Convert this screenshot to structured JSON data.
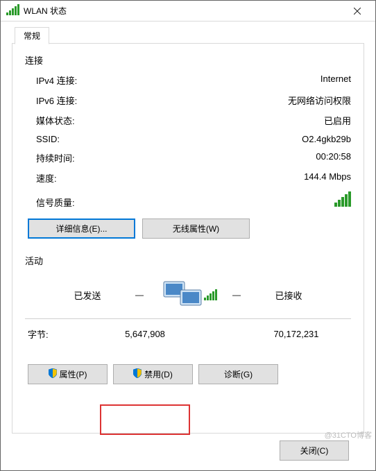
{
  "title": "WLAN 状态",
  "tab": {
    "general": "常规"
  },
  "connection": {
    "heading": "连接",
    "rows": {
      "ipv4": {
        "label": "IPv4 连接:",
        "value": "Internet"
      },
      "ipv6": {
        "label": "IPv6 连接:",
        "value": "无网络访问权限"
      },
      "media": {
        "label": "媒体状态:",
        "value": "已启用"
      },
      "ssid": {
        "label": "SSID:",
        "value": "O2.4gkb29b"
      },
      "duration": {
        "label": "持续时间:",
        "value": "00:20:58"
      },
      "speed": {
        "label": "速度:",
        "value": "144.4 Mbps"
      }
    },
    "signal_label": "信号质量:",
    "details_btn": "详细信息(E)...",
    "wireless_btn": "无线属性(W)"
  },
  "activity": {
    "heading": "活动",
    "sent": "已发送",
    "received": "已接收",
    "bytes_label": "字节:",
    "bytes_sent": "5,647,908",
    "bytes_received": "70,172,231"
  },
  "buttons": {
    "properties": "属性(P)",
    "disable": "禁用(D)",
    "diagnose": "诊断(G)",
    "close": "关闭(C)"
  },
  "watermark": "@31CTO博客"
}
